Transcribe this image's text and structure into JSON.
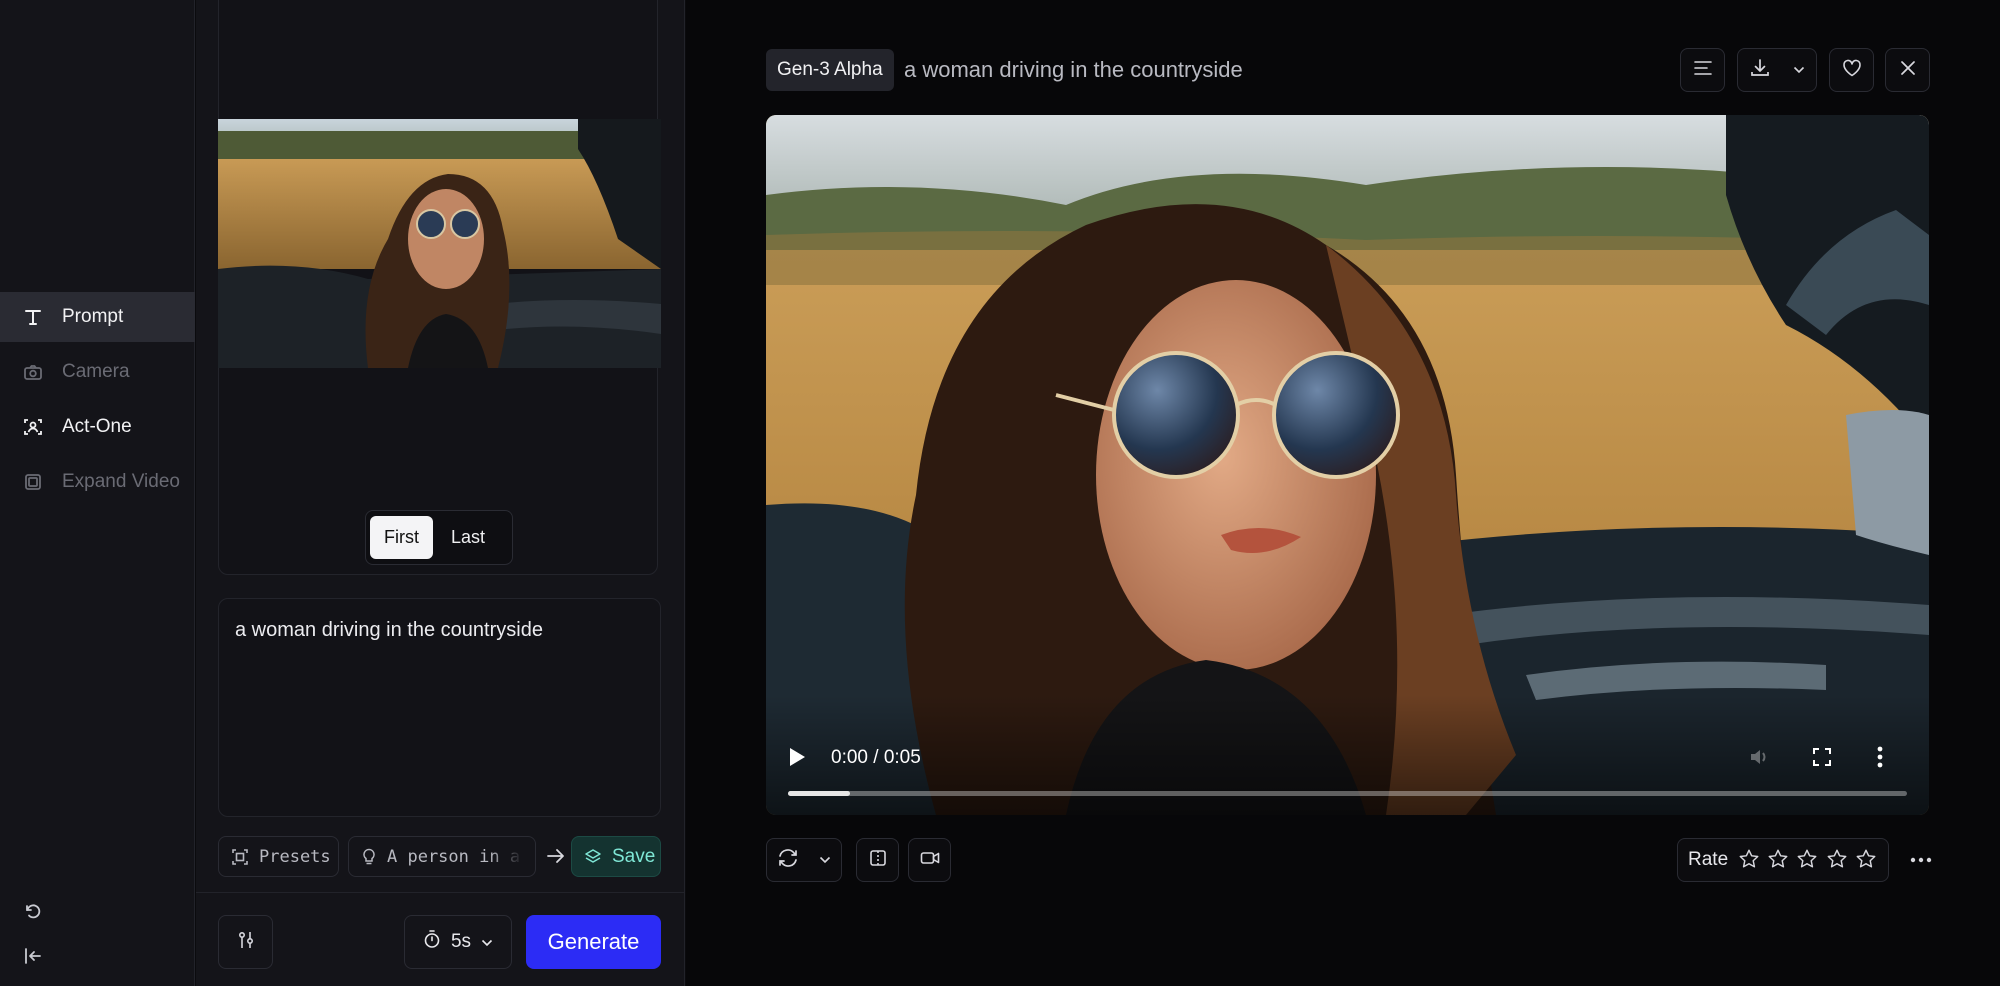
{
  "nav": {
    "items": [
      {
        "label": "Prompt",
        "icon": "text-icon",
        "state": "active"
      },
      {
        "label": "Camera",
        "icon": "camera-icon",
        "state": "disabled"
      },
      {
        "label": "Act-One",
        "icon": "face-scan-icon",
        "state": "normal"
      },
      {
        "label": "Expand Video",
        "icon": "expand-frame-icon",
        "state": "disabled"
      }
    ],
    "bottom_icons": [
      "undo-icon",
      "collapse-sidebar-icon"
    ]
  },
  "panel": {
    "frame_toggle": {
      "options": [
        "First",
        "Last"
      ],
      "selected": "First"
    },
    "prompt_text": "a woman driving in the countryside",
    "presets_label": "Presets",
    "idea_text": "A person in a c",
    "save_label": "Save",
    "duration": "5s",
    "generate_label": "Generate"
  },
  "viewer": {
    "model": "Gen-3 Alpha",
    "title": "a woman driving in the countryside",
    "video": {
      "time": "0:00 / 0:05",
      "progress_fraction": 0.055
    },
    "rate_label": "Rate",
    "stars": 5,
    "rating": 0
  },
  "colors": {
    "accent": "#2c2cf5",
    "save_text": "#7fe7d6",
    "background": "#070709",
    "panel": "#141419"
  }
}
